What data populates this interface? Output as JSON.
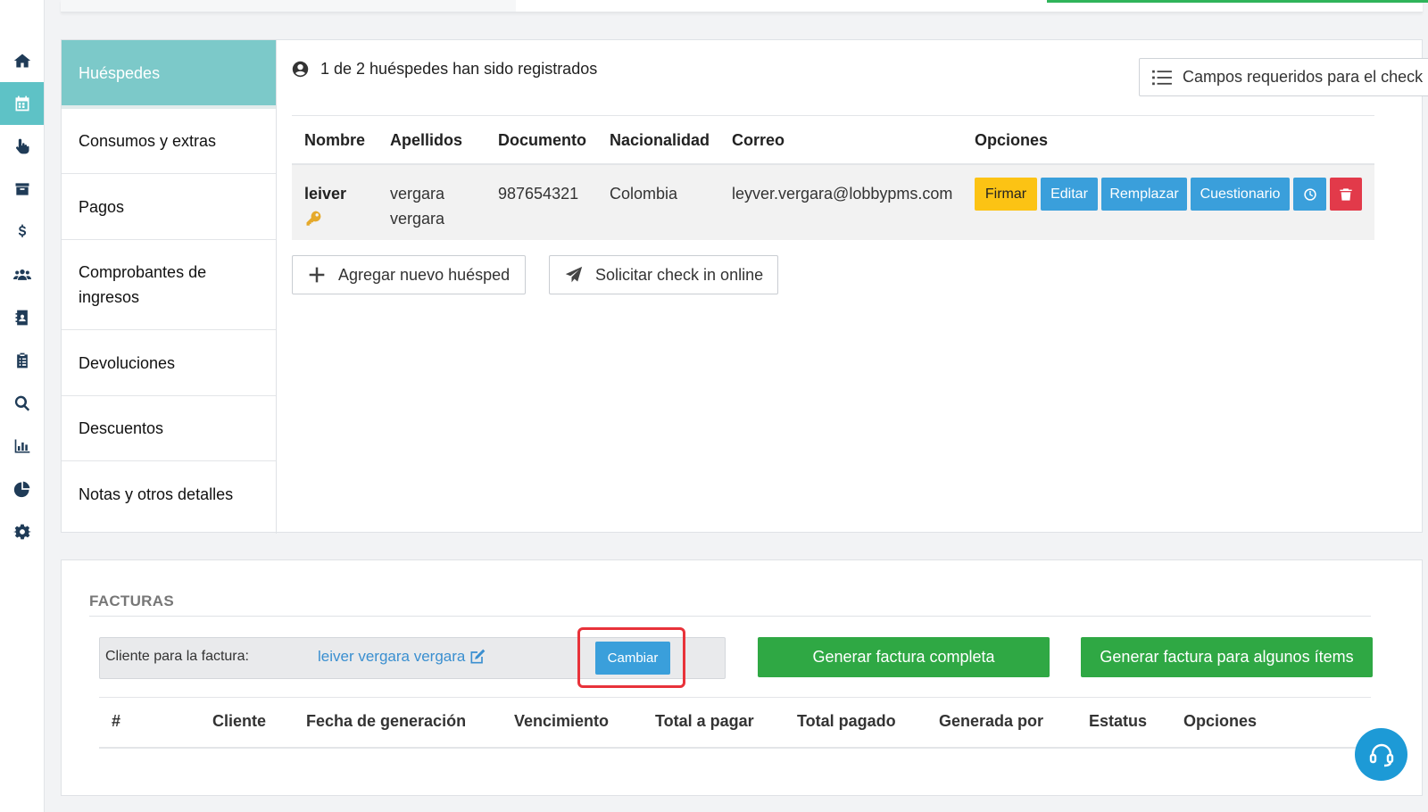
{
  "rail": {
    "items": [
      {
        "icon": "home-icon"
      },
      {
        "icon": "calendar-icon",
        "active": true
      },
      {
        "icon": "hand-pointer-icon"
      },
      {
        "icon": "archive-icon"
      },
      {
        "icon": "dollar-icon"
      },
      {
        "icon": "users-icon"
      },
      {
        "icon": "address-book-icon"
      },
      {
        "icon": "clipboard-icon"
      },
      {
        "icon": "search-icon"
      },
      {
        "icon": "bar-chart-icon"
      },
      {
        "icon": "pie-chart-icon"
      },
      {
        "icon": "gear-icon"
      }
    ]
  },
  "tabs": {
    "items": [
      {
        "label": "Huéspedes",
        "active": true
      },
      {
        "label": "Consumos y extras"
      },
      {
        "label": "Pagos"
      },
      {
        "label": "Comprobantes de ingresos"
      },
      {
        "label": "Devoluciones"
      },
      {
        "label": "Descuentos"
      },
      {
        "label": "Notas y otros detalles"
      }
    ]
  },
  "guests": {
    "registered_text": "1 de 2 huéspedes han sido registrados",
    "required_fields_button": "Campos requeridos para el check in",
    "columns": [
      "Nombre",
      "Apellidos",
      "Documento",
      "Nacionalidad",
      "Correo",
      "Opciones"
    ],
    "rows": [
      {
        "name": "leiver",
        "surname_1": "vergara",
        "surname_2": "vergara",
        "document": "987654321",
        "nationality": "Colombia",
        "email": "leyver.vergara@lobbypms.com"
      }
    ],
    "row_actions": {
      "sign": "Firmar",
      "edit": "Editar",
      "replace": "Remplazar",
      "questionnaire": "Cuestionario"
    },
    "add_guest_button": "Agregar nuevo huésped",
    "request_checkin_button": "Solicitar check in online"
  },
  "invoices": {
    "title": "FACTURAS",
    "client_label": "Cliente para la factura:",
    "client_name": "leiver vergara vergara",
    "change_button": "Cambiar",
    "generate_full_button": "Generar factura completa",
    "generate_some_button": "Generar factura para algunos ítems",
    "columns": [
      "#",
      "Cliente",
      "Fecha de generación",
      "Vencimiento",
      "Total a pagar",
      "Total pagado",
      "Generada por",
      "Estatus",
      "Opciones"
    ]
  },
  "colors": {
    "accent_teal": "#5ec2c6",
    "tab_active": "#7cc9c9",
    "primary_blue": "#3a9fdb",
    "warning_yellow": "#fcc314",
    "danger_red": "#e23a4a",
    "success_green": "#2fa844",
    "highlight_red": "#e8323a"
  }
}
